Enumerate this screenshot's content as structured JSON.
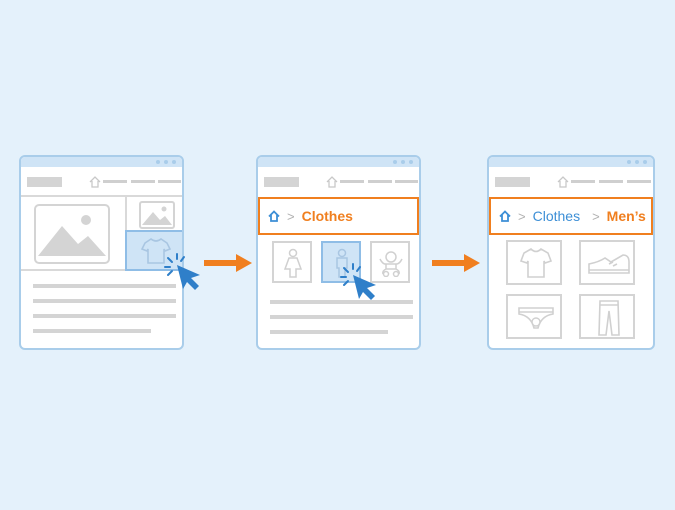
{
  "diagram": {
    "description": "Breadcrumb navigation flow: home page -> Clothes category -> Men's subcategory",
    "colors": {
      "background": "#e4f1fb",
      "accent": "#f07f1f",
      "link": "#3d8fd6",
      "window_border": "#a9cdea",
      "placeholder": "#d4d4d4",
      "cursor": "#2f7fc9"
    },
    "steps": [
      {
        "name": "home-page",
        "tiles": [
          "image",
          "image",
          "t-shirt"
        ],
        "selected_tile": "t-shirt"
      },
      {
        "name": "clothes-page",
        "breadcrumb": {
          "home_icon": "home-icon",
          "separator": ">",
          "current": "Clothes"
        },
        "tiles": [
          "women",
          "men",
          "baby"
        ],
        "selected_tile": "men"
      },
      {
        "name": "mens-page",
        "breadcrumb": {
          "home_icon": "home-icon",
          "separator": ">",
          "link": "Clothes",
          "current": "Men’s"
        },
        "tiles": [
          "t-shirt",
          "sneaker",
          "underwear",
          "pants"
        ]
      }
    ],
    "arrows": [
      "arrow-right",
      "arrow-right"
    ]
  }
}
